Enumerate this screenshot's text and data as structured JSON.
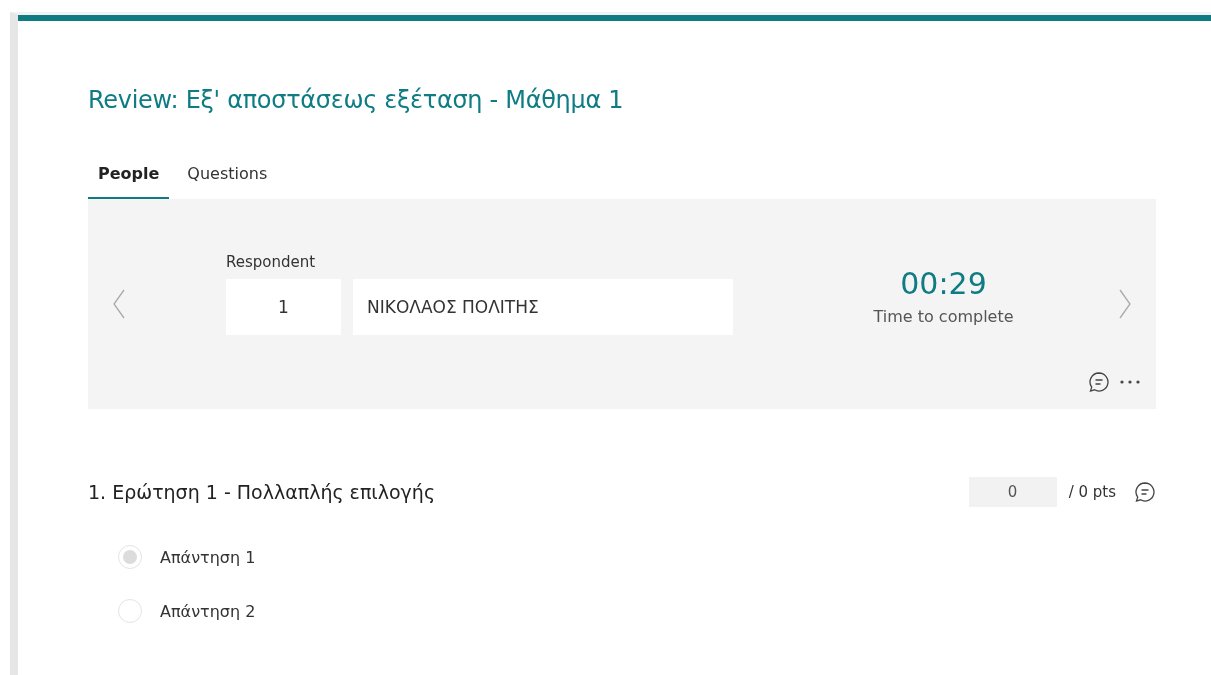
{
  "title": "Review: Εξ' αποστάσεως εξέταση - Μάθημα 1",
  "tabs": [
    {
      "label": "People",
      "selected": true
    },
    {
      "label": "Questions",
      "selected": false
    }
  ],
  "respondent": {
    "label": "Respondent",
    "number": "1",
    "name": "ΝΙΚΟΛΑΟΣ ΠΟΛΙΤΗΣ",
    "time": "00:29",
    "time_label": "Time to complete"
  },
  "question": {
    "title": "1. Ερώτηση 1 - Πολλαπλής επιλογής",
    "score": "0",
    "points": "/ 0 pts",
    "options": [
      {
        "label": "Απάντηση 1",
        "selected": true
      },
      {
        "label": "Απάντηση 2",
        "selected": false
      }
    ]
  }
}
